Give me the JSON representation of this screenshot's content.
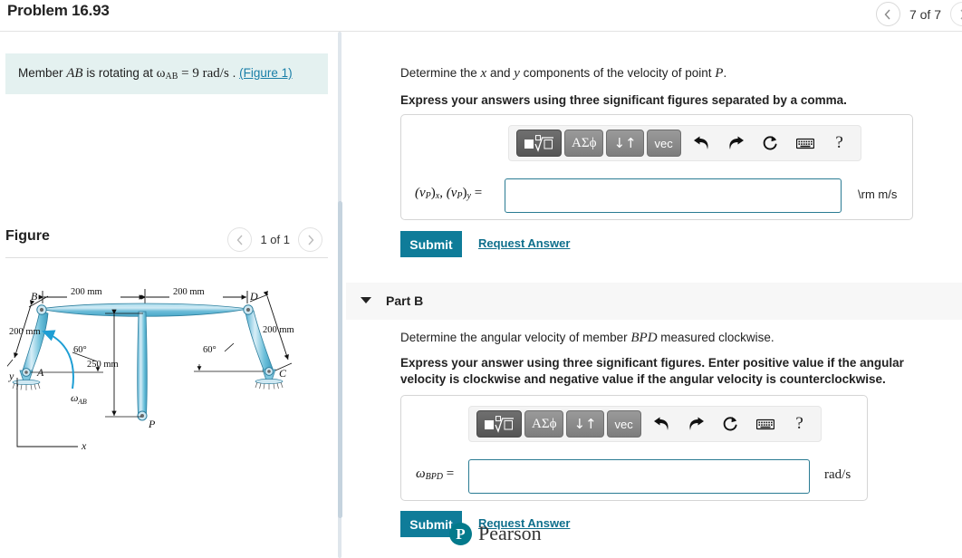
{
  "header": {
    "problem_title": "Problem 16.93",
    "prev_icon": "chevron-left-icon",
    "next_icon": "chevron-right-icon",
    "pager_label": "7 of 7"
  },
  "left_panel": {
    "hint": {
      "prefix": "Member ",
      "member": "AB",
      "mid": " is rotating at ",
      "omega": "ω",
      "omega_sub": "AB",
      "equals": " = 9 ",
      "units": "rad/s",
      "period": " . ",
      "figure_link": "(Figure 1)"
    },
    "figure": {
      "title": "Figure",
      "prev_icon": "chevron-left-icon",
      "next_icon": "chevron-right-icon",
      "pager_label": "1 of 1",
      "labels": {
        "dim_top_left": "200 mm",
        "dim_top_right": "200 mm",
        "dim_left_arm": "200 mm",
        "dim_right_arm": "200 mm",
        "dim_vertical": "250 mm",
        "angle_left": "60°",
        "angle_right": "60°",
        "point_a": "A",
        "point_b": "B",
        "point_c": "C",
        "point_d": "D",
        "point_p": "P",
        "omega_ab": "ω",
        "omega_ab_sub": "AB",
        "axis_x": "x",
        "axis_y": "y"
      }
    }
  },
  "part_a": {
    "question": {
      "pre": "Determine the ",
      "var_x": "x",
      "mid": " and ",
      "var_y": "y",
      "post": " components of the velocity of point ",
      "point": "P",
      "end": "."
    },
    "instruction": "Express your answers using three significant figures separated by a comma.",
    "toolbar": {
      "sqrt_label": "√",
      "greek_label": "ΑΣϕ",
      "updown_label": "↓↑",
      "vec_label": "vec",
      "undo_icon": "undo-arrow-icon",
      "redo_icon": "redo-arrow-icon",
      "reset_icon": "reset-circle-icon",
      "keyboard_icon": "keyboard-icon",
      "help_label": "?"
    },
    "answer_label_a": "(v",
    "answer_label_b": "P",
    "answer_label_c": ")",
    "answer_label_x": "x",
    "answer_label_y": "y",
    "answer_label_full": "(v_P)_x, (v_P)_y =",
    "answer_value": "",
    "answer_placeholder": "",
    "unit": "\\rm m/s",
    "submit_label": "Submit",
    "request_answer_label": "Request Answer"
  },
  "part_b": {
    "caret_icon": "caret-down-icon",
    "header_label": "Part B",
    "question": {
      "pre": "Determine the angular velocity of member ",
      "member": "BPD",
      "post": " measured clockwise."
    },
    "instruction": "Express your answer using three significant figures. Enter positive value if the angular velocity is clockwise and negative value if the angular velocity is counterclockwise.",
    "toolbar": {
      "sqrt_label": "√",
      "greek_label": "ΑΣϕ",
      "updown_label": "↓↑",
      "vec_label": "vec",
      "undo_icon": "undo-arrow-icon",
      "redo_icon": "redo-arrow-icon",
      "reset_icon": "reset-circle-icon",
      "keyboard_icon": "keyboard-icon",
      "help_label": "?"
    },
    "answer_label_omega": "ω",
    "answer_label_sub": "BPD",
    "answer_label_eq": " =",
    "answer_value": "",
    "unit": "rad/s",
    "submit_label": "Submit",
    "request_answer_label": "Request Answer"
  },
  "footer": {
    "brand_mark": "P",
    "brand_name": "Pearson"
  },
  "colors": {
    "accent_teal": "#0f7c99",
    "link_teal": "#1a7fa8",
    "hint_bg": "#e4f1f0",
    "input_border": "#2a7b93",
    "pearson_teal": "#047a8c",
    "figure_blue": "#6ec6e0"
  }
}
